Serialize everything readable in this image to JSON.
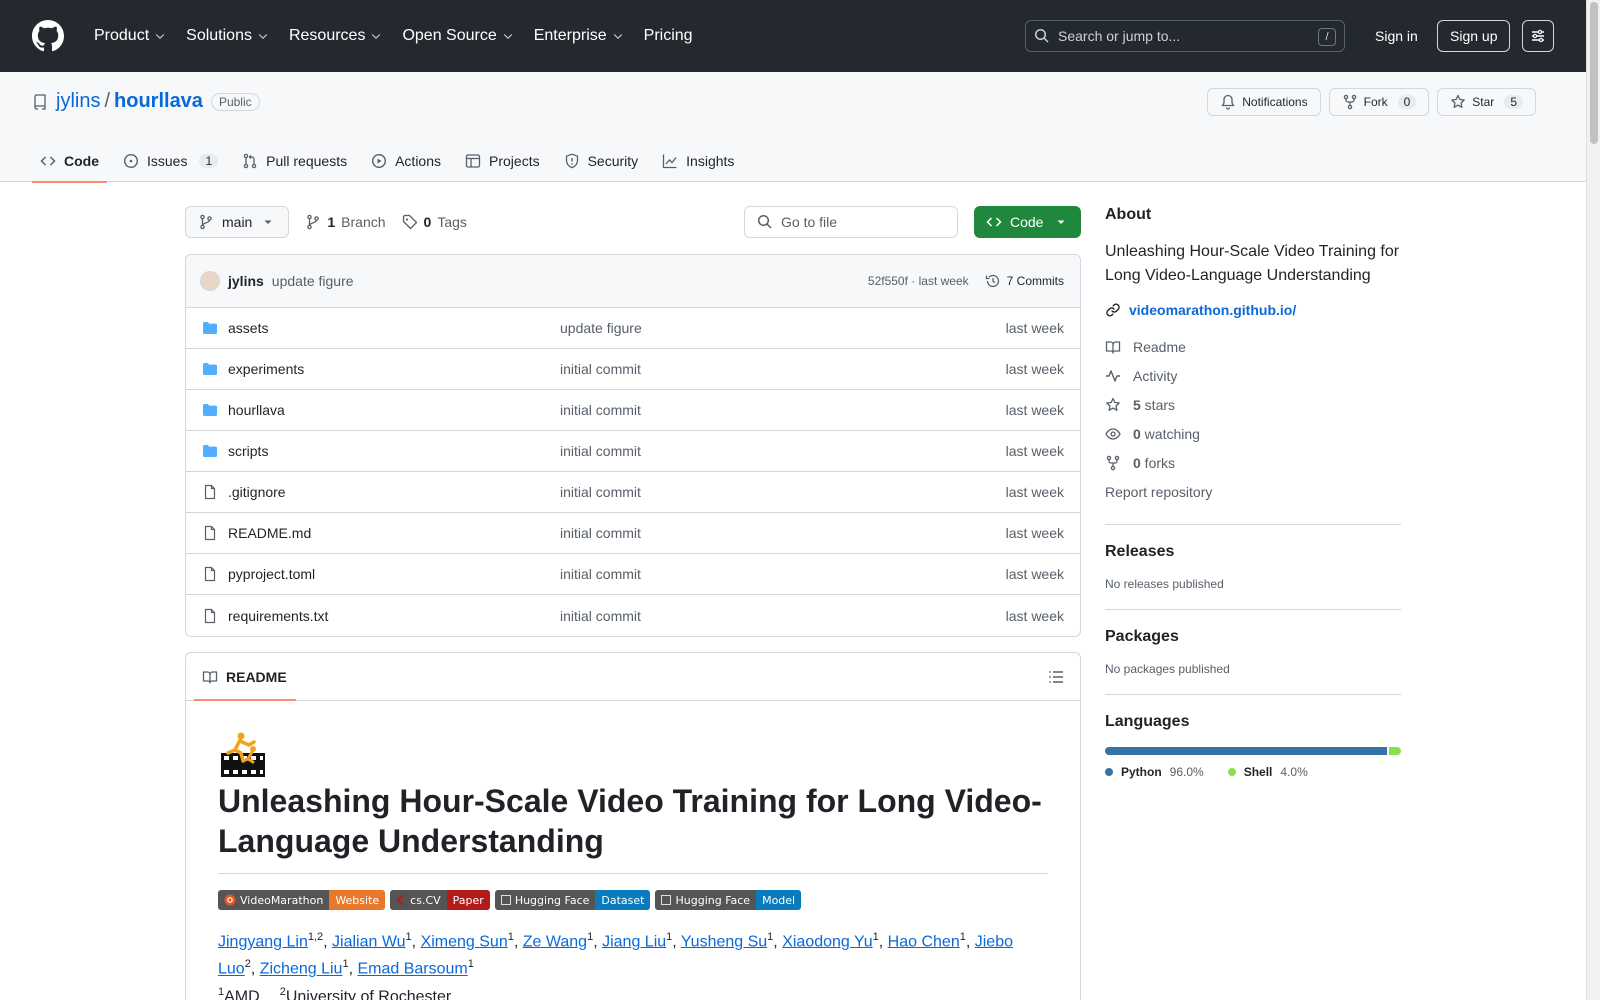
{
  "header": {
    "nav": [
      "Product",
      "Solutions",
      "Resources",
      "Open Source",
      "Enterprise",
      "Pricing"
    ],
    "search_placeholder": "Search or jump to...",
    "search_shortcut": "/",
    "sign_in": "Sign in",
    "sign_up": "Sign up"
  },
  "repo": {
    "owner": "jylins",
    "separator": "/",
    "name": "hourllava",
    "visibility": "Public",
    "actions": {
      "notifications": "Notifications",
      "fork": "Fork",
      "fork_count": "0",
      "star": "Star",
      "star_count": "5"
    },
    "tabs": [
      {
        "label": "Code",
        "icon": "code-icon"
      },
      {
        "label": "Issues",
        "icon": "issue-icon",
        "count": "1"
      },
      {
        "label": "Pull requests",
        "icon": "pull-request-icon"
      },
      {
        "label": "Actions",
        "icon": "play-icon"
      },
      {
        "label": "Projects",
        "icon": "table-icon"
      },
      {
        "label": "Security",
        "icon": "shield-icon"
      },
      {
        "label": "Insights",
        "icon": "graph-icon"
      }
    ]
  },
  "toolbar": {
    "branch": "main",
    "branch_count": "1",
    "branch_label": "Branch",
    "tag_count": "0",
    "tag_label": "Tags",
    "go_to_file": "Go to file",
    "code": "Code"
  },
  "latest_commit": {
    "author": "jylins",
    "message": "update figure",
    "sha": "52f550f",
    "sep": "·",
    "age": "last week",
    "commits_count": "7 Commits"
  },
  "files": [
    {
      "name": "assets",
      "type": "folder",
      "message": "update figure",
      "age": "last week"
    },
    {
      "name": "experiments",
      "type": "folder",
      "message": "initial commit",
      "age": "last week"
    },
    {
      "name": "hourllava",
      "type": "folder",
      "message": "initial commit",
      "age": "last week"
    },
    {
      "name": "scripts",
      "type": "folder",
      "message": "initial commit",
      "age": "last week"
    },
    {
      "name": ".gitignore",
      "type": "file",
      "message": "initial commit",
      "age": "last week"
    },
    {
      "name": "README.md",
      "type": "file",
      "message": "initial commit",
      "age": "last week"
    },
    {
      "name": "pyproject.toml",
      "type": "file",
      "message": "initial commit",
      "age": "last week"
    },
    {
      "name": "requirements.txt",
      "type": "file",
      "message": "initial commit",
      "age": "last week"
    }
  ],
  "readme": {
    "tab_label": "README",
    "title": "Unleashing Hour-Scale Video Training for Long Video-Language Understanding",
    "badges": [
      {
        "left": "VideoMarathon",
        "right": "Website",
        "color": "#e8782a",
        "icon": "ubuntu-icon"
      },
      {
        "left": "cs.CV",
        "right": "Paper",
        "color": "#b31b1b",
        "icon": "arxiv-icon"
      },
      {
        "left": "Hugging Face",
        "right": "Dataset",
        "color": "#0a7bbd",
        "icon": "broken-image-icon"
      },
      {
        "left": "Hugging Face",
        "right": "Model",
        "color": "#0a7bbd",
        "icon": "broken-image-icon"
      }
    ],
    "authors": [
      {
        "name": "Jingyang Lin",
        "sup": "1,2"
      },
      {
        "name": "Jialian Wu",
        "sup": "1"
      },
      {
        "name": "Ximeng Sun",
        "sup": "1"
      },
      {
        "name": "Ze Wang",
        "sup": "1"
      },
      {
        "name": "Jiang Liu",
        "sup": "1"
      },
      {
        "name": "Yusheng Su",
        "sup": "1"
      },
      {
        "name": "Xiaodong Yu",
        "sup": "1"
      },
      {
        "name": "Hao Chen",
        "sup": "1"
      },
      {
        "name": "Jiebo Luo",
        "sup": "2"
      },
      {
        "name": "Zicheng Liu",
        "sup": "1"
      },
      {
        "name": "Emad Barsoum",
        "sup": "1"
      }
    ],
    "affiliations": [
      {
        "sup": "1",
        "name": "AMD"
      },
      {
        "sup": "2",
        "name": "University of Rochester"
      }
    ]
  },
  "about": {
    "heading": "About",
    "description": "Unleashing Hour-Scale Video Training for Long Video-Language Understanding",
    "homepage": "videomarathon.github.io/",
    "items": [
      {
        "icon": "book-icon",
        "label": "Readme",
        "bold": ""
      },
      {
        "icon": "pulse-icon",
        "label": "Activity",
        "bold": ""
      },
      {
        "icon": "star-icon",
        "bold": "5",
        "label": " stars"
      },
      {
        "icon": "eye-icon",
        "bold": "0",
        "label": " watching"
      },
      {
        "icon": "fork-icon",
        "bold": "0",
        "label": " forks"
      }
    ],
    "report": "Report repository"
  },
  "releases": {
    "heading": "Releases",
    "empty": "No releases published"
  },
  "packages": {
    "heading": "Packages",
    "empty": "No packages published"
  },
  "languages": {
    "heading": "Languages",
    "items": [
      {
        "name": "Python",
        "percent": "96.0%",
        "share": 96.0,
        "color": "#3572A5"
      },
      {
        "name": "Shell",
        "percent": "4.0%",
        "share": 4.0,
        "color": "#89e051"
      }
    ]
  }
}
